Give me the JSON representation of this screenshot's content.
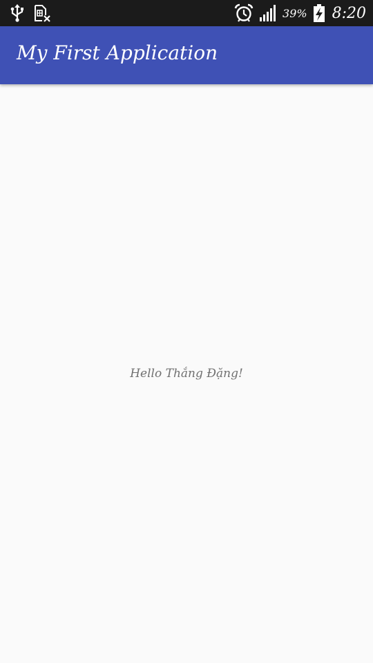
{
  "status_bar": {
    "battery_percent": "39%",
    "time": "8:20",
    "icons": [
      "usb-icon",
      "sim-card-icon",
      "alarm-icon",
      "signal-icon",
      "battery-charging-icon"
    ]
  },
  "app_bar": {
    "title": "My First Application",
    "color": "#3f51b5"
  },
  "main": {
    "hello_text": "Hello Thắng Đặng!"
  },
  "colors": {
    "status_bar_bg": "#1b1b1b",
    "background": "#fafafa",
    "text": "#707070"
  }
}
